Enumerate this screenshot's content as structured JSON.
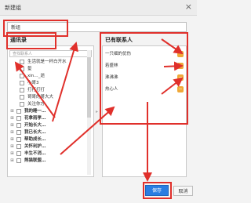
{
  "window": {
    "title": "新建组",
    "close_symbol": "×"
  },
  "group_name": {
    "value": "新组"
  },
  "left_panel": {
    "title": "通讯录",
    "search_placeholder": "查找联系人",
    "items": [
      {
        "label": "生活就是一杯白开水",
        "type": "contact"
      },
      {
        "label": "髪",
        "type": "contact"
      },
      {
        "label": "xin…_逝",
        "type": "contact"
      },
      {
        "label": "小哥3",
        "type": "contact"
      },
      {
        "label": "打打打打",
        "type": "contact"
      },
      {
        "label": "哥哥的哥大大",
        "type": "contact"
      },
      {
        "label": "关注你方",
        "type": "contact"
      },
      {
        "label": "我的睡一…",
        "type": "group",
        "toggle": "⊞"
      },
      {
        "label": "花拿雨孝…",
        "type": "group",
        "toggle": "⊞"
      },
      {
        "label": "开始长大…",
        "type": "group",
        "toggle": "⊞"
      },
      {
        "label": "我已长大…",
        "type": "group",
        "toggle": "⊞"
      },
      {
        "label": "帮助成长…",
        "type": "group",
        "toggle": "⊞"
      },
      {
        "label": "关怀利护…",
        "type": "group",
        "toggle": "⊞"
      },
      {
        "label": "丰生不消…",
        "type": "group",
        "toggle": "⊞"
      },
      {
        "label": "熊猫联盟…",
        "type": "group",
        "toggle": "⊞"
      }
    ]
  },
  "transfer_arrow": "▸",
  "right_panel": {
    "title": "已有联系人",
    "remove_symbol": "−",
    "items": [
      {
        "label": "一只细的优伤"
      },
      {
        "label": "若盛林"
      },
      {
        "label": "沸沸沸"
      },
      {
        "label": "热心人"
      }
    ]
  },
  "buttons": {
    "ok": "保存",
    "cancel": "取消"
  },
  "colors": {
    "annotation": "#e0302b",
    "primary": "#2a7de1",
    "remove": "#f0a838"
  }
}
